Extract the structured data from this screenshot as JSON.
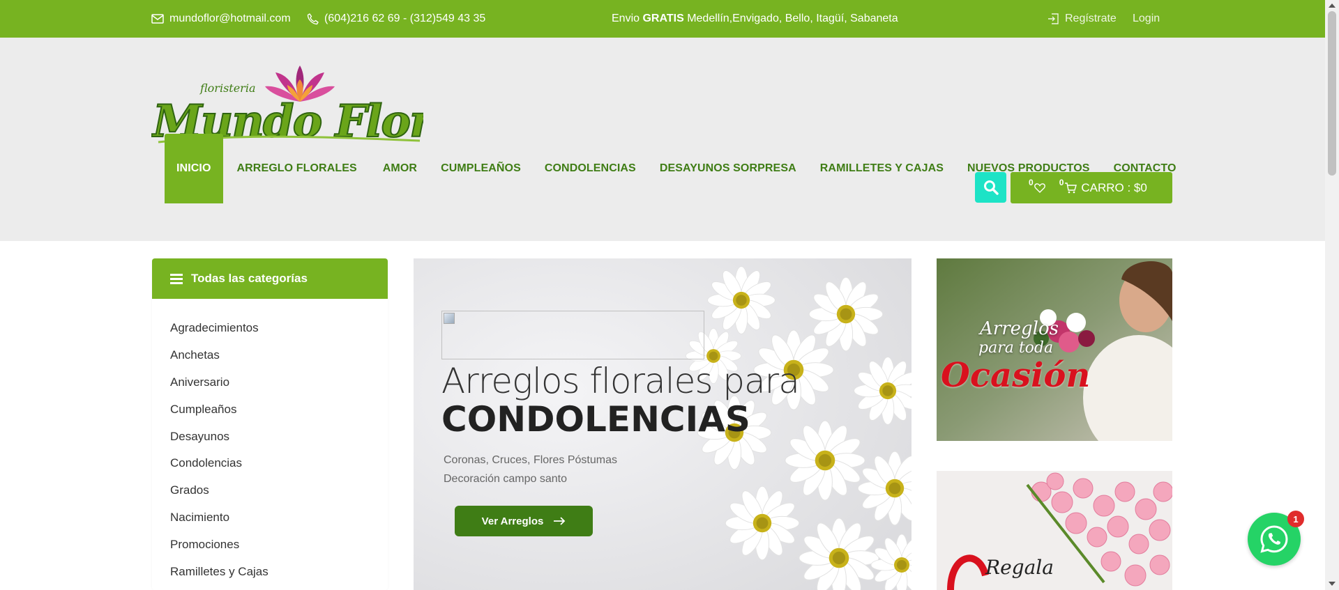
{
  "topbar": {
    "email": "mundoflor@hotmail.com",
    "phone": "(604)216 62 69 - (312)549 43 35",
    "shipping_prefix": "Envio",
    "shipping_bold": "GRATIS",
    "shipping_rest": "Medellín,Envigado, Bello, Itagüí, Sabaneta",
    "register": "Regístrate",
    "login": "Login"
  },
  "logo": {
    "small_text": "floristeria",
    "main_text": "Mundo Flor"
  },
  "nav": {
    "items": [
      "INICIO",
      "ARREGLO FLORALES",
      "AMOR",
      "CUMPLEAÑOS",
      "CONDOLENCIAS",
      "DESAYUNOS SORPRESA",
      "RAMILLETES Y CAJAS",
      "NUEVOS PRODUCTOS",
      "CONTACTO"
    ]
  },
  "cart": {
    "wishlist_count": "0",
    "cart_count": "0",
    "label": "CARRO : $0"
  },
  "categories": {
    "title": "Todas las categorías",
    "items": [
      "Agradecimientos",
      "Anchetas",
      "Aniversario",
      "Cumpleaños",
      "Desayunos",
      "Condolencias",
      "Grados",
      "Nacimiento",
      "Promociones",
      "Ramilletes y Cajas"
    ]
  },
  "hero": {
    "line1": "Arreglos florales para",
    "line2": "CONDOLENCIAS",
    "sub1": "Coronas, Cruces, Flores Póstumas",
    "sub2": "Decoración campo santo",
    "button": "Ver Arreglos"
  },
  "banners": {
    "b1_line1": "Arreglos",
    "b1_line2": "para toda",
    "b1_line3": "Ocasión",
    "b2_line1": "Regala"
  },
  "whatsapp": {
    "badge": "1"
  },
  "colors": {
    "brand_green": "#77b321",
    "dark_green": "#3f7d15",
    "teal": "#1de3c6",
    "header_bg": "#ececec"
  },
  "icons": [
    "envelope-icon",
    "phone-icon",
    "login-icon",
    "search-icon",
    "heart-icon",
    "cart-icon",
    "menu-icon",
    "arrow-right-icon",
    "whatsapp-icon"
  ]
}
